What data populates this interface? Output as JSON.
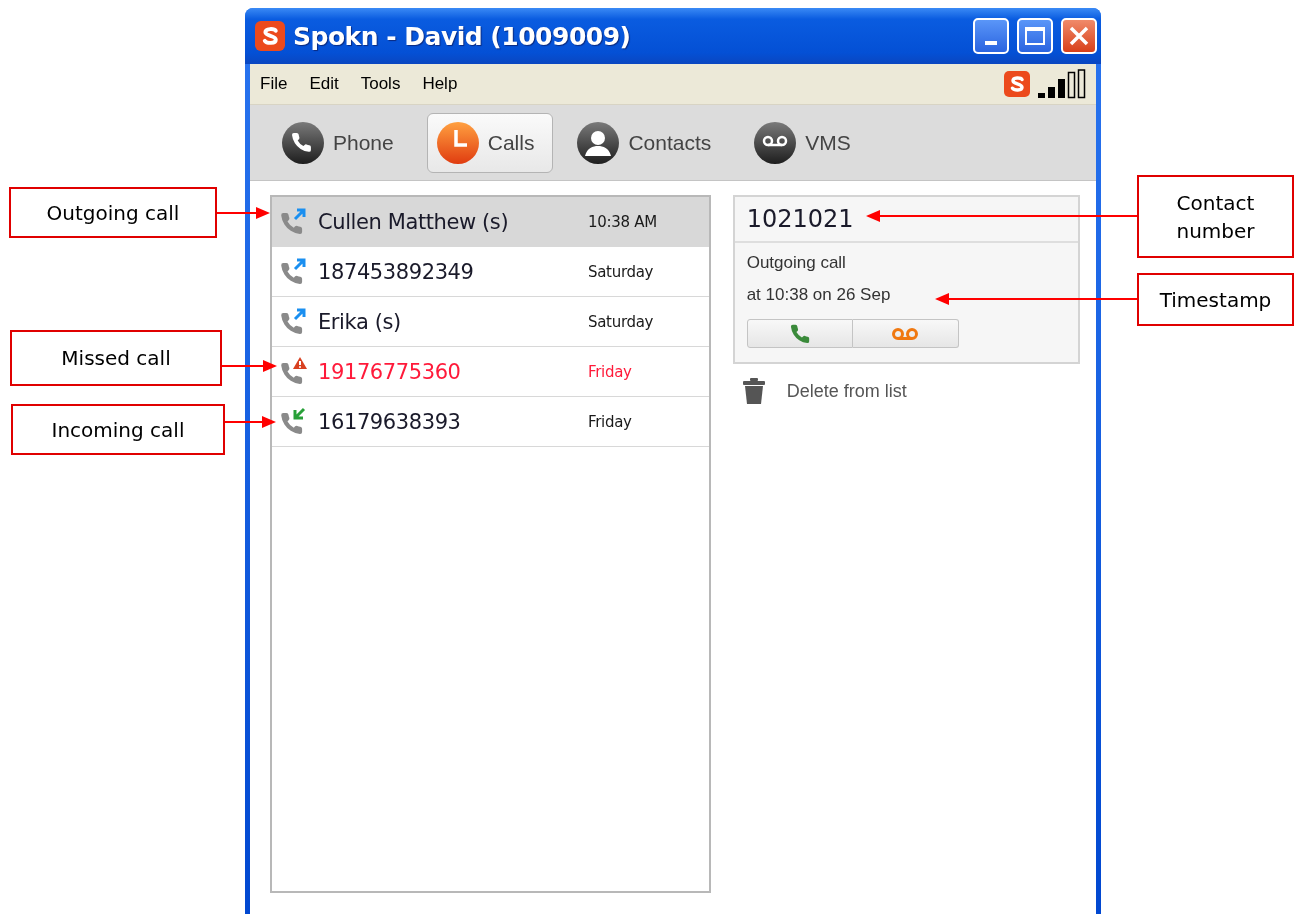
{
  "window": {
    "title": "Spokn - David (1009009)"
  },
  "menu": [
    "File",
    "Edit",
    "Tools",
    "Help"
  ],
  "tabs": [
    {
      "label": "Phone",
      "kind": "phone",
      "selected": false
    },
    {
      "label": "Calls",
      "kind": "calls",
      "selected": true
    },
    {
      "label": "Contacts",
      "kind": "contacts",
      "selected": false
    },
    {
      "label": "VMS",
      "kind": "vms",
      "selected": false
    }
  ],
  "calls": [
    {
      "name": "Cullen Matthew (s)",
      "time": "10:38 AM",
      "kind": "outgoing",
      "selected": true
    },
    {
      "name": "187453892349",
      "time": "Saturday",
      "kind": "outgoing",
      "selected": false
    },
    {
      "name": "Erika (s)",
      "time": "Saturday",
      "kind": "outgoing",
      "selected": false
    },
    {
      "name": "19176775360",
      "time": "Friday",
      "kind": "missed",
      "selected": false
    },
    {
      "name": "16179638393",
      "time": "Friday",
      "kind": "incoming",
      "selected": false
    }
  ],
  "detail": {
    "number": "1021021",
    "call_type": "Outgoing call",
    "timestamp": "at 10:38 on 26 Sep",
    "delete_label": "Delete from list"
  },
  "annotations": [
    {
      "label": "Outgoing call"
    },
    {
      "label": "Missed call"
    },
    {
      "label": "Incoming call"
    },
    {
      "label": "Contact number"
    },
    {
      "label": "Timestamp"
    }
  ]
}
